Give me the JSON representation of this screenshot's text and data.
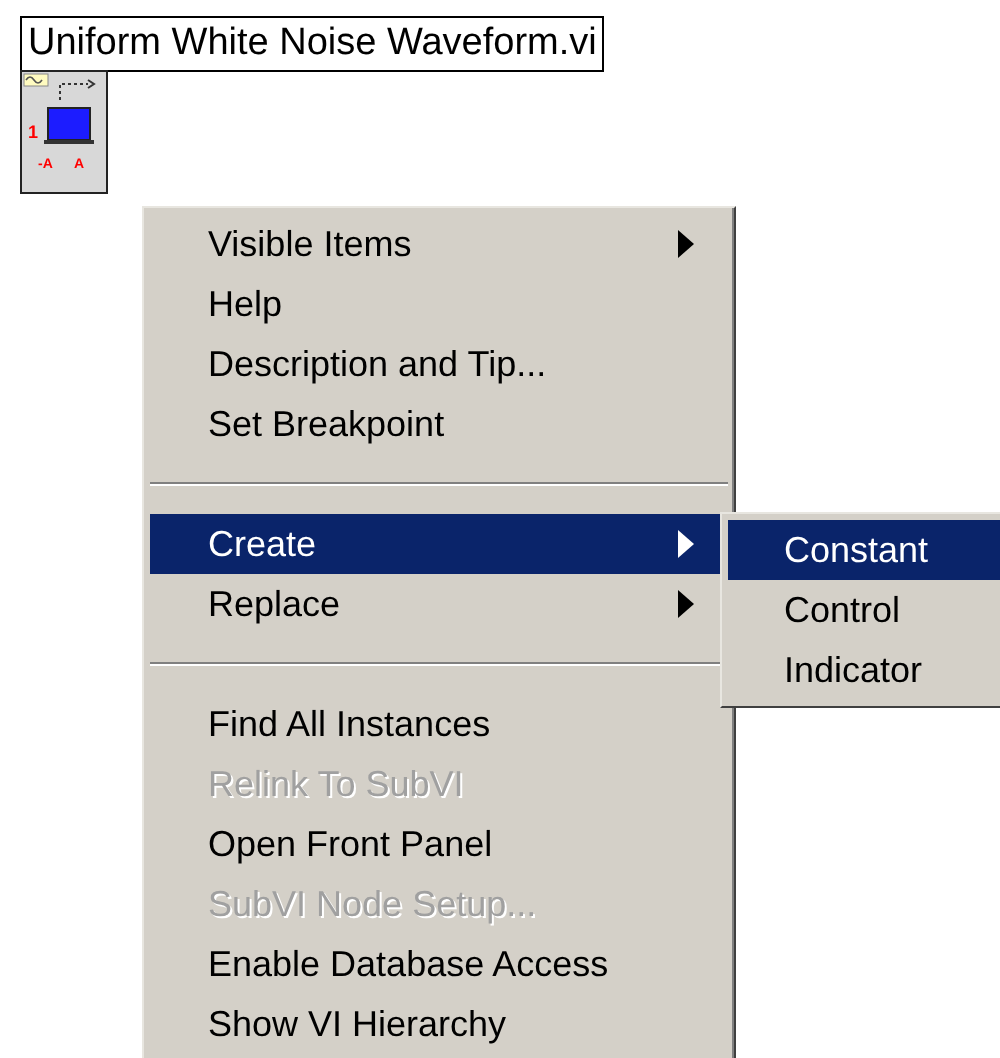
{
  "vi_label": "Uniform White Noise Waveform.vi",
  "icon_number": "1",
  "icon_terminals": [
    "-A",
    "A"
  ],
  "menu": [
    {
      "kind": "item",
      "label": "Visible Items",
      "submenu": true,
      "disabled": false,
      "selected": false
    },
    {
      "kind": "item",
      "label": "Help",
      "submenu": false,
      "disabled": false,
      "selected": false
    },
    {
      "kind": "item",
      "label": "Description and Tip...",
      "submenu": false,
      "disabled": false,
      "selected": false
    },
    {
      "kind": "item",
      "label": "Set Breakpoint",
      "submenu": false,
      "disabled": false,
      "selected": false
    },
    {
      "kind": "separator"
    },
    {
      "kind": "item",
      "label": "Create",
      "submenu": true,
      "disabled": false,
      "selected": true
    },
    {
      "kind": "item",
      "label": "Replace",
      "submenu": true,
      "disabled": false,
      "selected": false
    },
    {
      "kind": "separator"
    },
    {
      "kind": "item",
      "label": "Find All Instances",
      "submenu": false,
      "disabled": false,
      "selected": false
    },
    {
      "kind": "item",
      "label": "Relink To SubVI",
      "submenu": false,
      "disabled": true,
      "selected": false
    },
    {
      "kind": "item",
      "label": "Open Front Panel",
      "submenu": false,
      "disabled": false,
      "selected": false
    },
    {
      "kind": "item",
      "label": "SubVI Node Setup...",
      "submenu": false,
      "disabled": true,
      "selected": false
    },
    {
      "kind": "item",
      "label": "Enable Database Access",
      "submenu": false,
      "disabled": false,
      "selected": false
    },
    {
      "kind": "item",
      "label": "Show VI Hierarchy",
      "submenu": false,
      "disabled": false,
      "selected": false
    }
  ],
  "submenu": [
    {
      "label": "Constant",
      "selected": true
    },
    {
      "label": "Control",
      "selected": false
    },
    {
      "label": "Indicator",
      "selected": false
    }
  ]
}
